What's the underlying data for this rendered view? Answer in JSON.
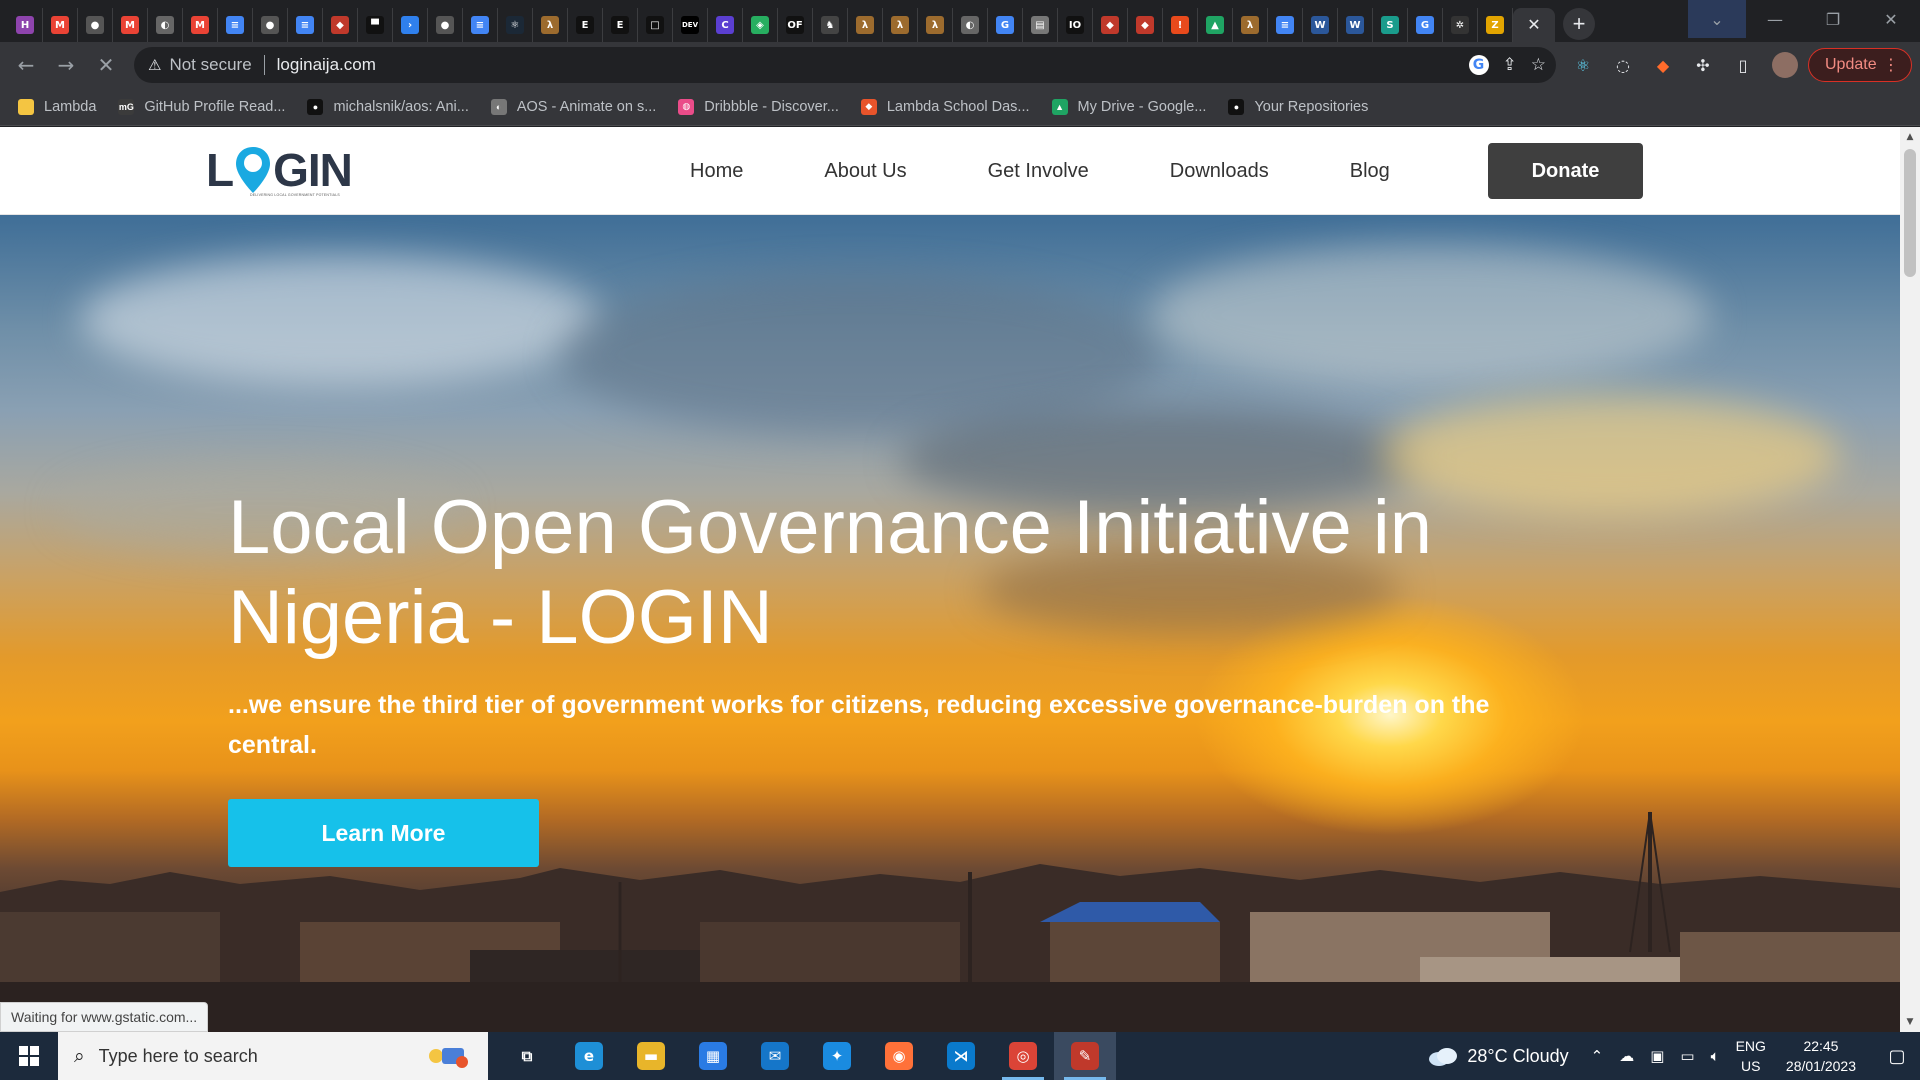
{
  "browser": {
    "tab_favicons": [
      {
        "name": "h-icon",
        "glyph": "H",
        "color": "#8e44ad"
      },
      {
        "name": "gmail-icon",
        "glyph": "M",
        "color": "#ea4335"
      },
      {
        "name": "github-icon",
        "glyph": "●",
        "color": "#555"
      },
      {
        "name": "gmail-icon",
        "glyph": "M",
        "color": "#ea4335"
      },
      {
        "name": "globe-icon",
        "glyph": "◐",
        "color": "#666"
      },
      {
        "name": "gmail-icon",
        "glyph": "M",
        "color": "#ea4335"
      },
      {
        "name": "docs-icon",
        "glyph": "≡",
        "color": "#4285f4"
      },
      {
        "name": "github-icon",
        "glyph": "●",
        "color": "#555"
      },
      {
        "name": "docs-icon",
        "glyph": "≡",
        "color": "#4285f4"
      },
      {
        "name": "shield-icon",
        "glyph": "◆",
        "color": "#c0392b"
      },
      {
        "name": "bag-icon",
        "glyph": "▀",
        "color": "#111"
      },
      {
        "name": "code-icon",
        "glyph": "›",
        "color": "#2f80ed"
      },
      {
        "name": "github-icon",
        "glyph": "●",
        "color": "#555"
      },
      {
        "name": "docs-icon",
        "glyph": "≡",
        "color": "#4285f4"
      },
      {
        "name": "react-icon",
        "glyph": "⚛",
        "color": "#1b2836"
      },
      {
        "name": "lambda-icon",
        "glyph": "λ",
        "color": "#9c6b2e"
      },
      {
        "name": "e-icon",
        "glyph": "E",
        "color": "#111"
      },
      {
        "name": "e-icon",
        "glyph": "E",
        "color": "#111"
      },
      {
        "name": "square-icon",
        "glyph": "□",
        "color": "#111"
      },
      {
        "name": "dev-icon",
        "glyph": "DEV",
        "color": "#000"
      },
      {
        "name": "c-icon",
        "glyph": "C",
        "color": "#5b3fd1"
      },
      {
        "name": "layers-icon",
        "glyph": "◈",
        "color": "#27ae60"
      },
      {
        "name": "of-icon",
        "glyph": "OF",
        "color": "#111"
      },
      {
        "name": "person-icon",
        "glyph": "♞",
        "color": "#444"
      },
      {
        "name": "lambda-icon",
        "glyph": "λ",
        "color": "#9c6b2e"
      },
      {
        "name": "lambda-icon",
        "glyph": "λ",
        "color": "#9c6b2e"
      },
      {
        "name": "lambda-icon",
        "glyph": "λ",
        "color": "#9c6b2e"
      },
      {
        "name": "globe-icon",
        "glyph": "◐",
        "color": "#666"
      },
      {
        "name": "google-icon",
        "glyph": "G",
        "color": "#4285f4"
      },
      {
        "name": "page-icon",
        "glyph": "▤",
        "color": "#777"
      },
      {
        "name": "io-icon",
        "glyph": "IO",
        "color": "#111"
      },
      {
        "name": "brave-icon",
        "glyph": "◆",
        "color": "#c0392b"
      },
      {
        "name": "brave-icon",
        "glyph": "◆",
        "color": "#c0392b"
      },
      {
        "name": "alert-icon",
        "glyph": "!",
        "color": "#e84a1c"
      },
      {
        "name": "drive-icon",
        "glyph": "▲",
        "color": "#1fa463"
      },
      {
        "name": "lambda-icon",
        "glyph": "λ",
        "color": "#9c6b2e"
      },
      {
        "name": "docs-icon",
        "glyph": "≡",
        "color": "#4285f4"
      },
      {
        "name": "word-icon",
        "glyph": "W",
        "color": "#2b579a"
      },
      {
        "name": "word-icon",
        "glyph": "W",
        "color": "#2b579a"
      },
      {
        "name": "s-icon",
        "glyph": "S",
        "color": "#1a9c8c"
      },
      {
        "name": "google-icon",
        "glyph": "G",
        "color": "#4285f4"
      },
      {
        "name": "gear-icon",
        "glyph": "✲",
        "color": "#333"
      },
      {
        "name": "zoho-icon",
        "glyph": "Z",
        "color": "#e2a400"
      }
    ],
    "address": {
      "security_label": "Not secure",
      "url": "loginaija.com"
    },
    "update_label": "Update",
    "bookmarks": [
      {
        "label": "Lambda",
        "color": "#f4c542",
        "glyph": ""
      },
      {
        "label": "GitHub Profile Read...",
        "color": "#3b3b3b",
        "glyph": "mG"
      },
      {
        "label": "michalsnik/aos: Ani...",
        "color": "#111",
        "glyph": "●"
      },
      {
        "label": "AOS - Animate on s...",
        "color": "#777",
        "glyph": "◐"
      },
      {
        "label": "Dribbble - Discover...",
        "color": "#ea4c89",
        "glyph": "◍"
      },
      {
        "label": "Lambda School Das...",
        "color": "#e8542b",
        "glyph": "◆"
      },
      {
        "label": "My Drive - Google...",
        "color": "#1fa463",
        "glyph": "▲"
      },
      {
        "label": "Your Repositories",
        "color": "#111",
        "glyph": "●"
      }
    ],
    "status_text": "Waiting for www.gstatic.com..."
  },
  "site": {
    "logo_text_left": "L",
    "logo_text_right": "GIN",
    "logo_tagline": "DELIVERING LOCAL GOVERNMENT POTENTIALS",
    "nav": [
      "Home",
      "About Us",
      "Get Involve",
      "Downloads",
      "Blog"
    ],
    "donate_label": "Donate",
    "hero": {
      "title": "Local Open Governance Initiative in Nigeria - LOGIN",
      "subtitle": "...we ensure the third tier of government works for citizens, reducing excessive governance-burden on the central.",
      "cta_label": "Learn More"
    },
    "colors": {
      "cta": "#16c1ea",
      "donate": "#3f3f3f",
      "logo_pin": "#1aa9e1"
    }
  },
  "taskbar": {
    "search_placeholder": "Type here to search",
    "apps": [
      {
        "name": "task-view-icon",
        "glyph": "⧉",
        "color": "transparent"
      },
      {
        "name": "edge-icon",
        "glyph": "e",
        "color": "#1e8fd6"
      },
      {
        "name": "file-explorer-icon",
        "glyph": "▬",
        "color": "#e8b52a"
      },
      {
        "name": "store-icon",
        "glyph": "▦",
        "color": "#2a7be4"
      },
      {
        "name": "mail-icon",
        "glyph": "✉",
        "color": "#1576c9"
      },
      {
        "name": "safari-icon",
        "glyph": "✦",
        "color": "#1a8be0"
      },
      {
        "name": "firefox-icon",
        "glyph": "◉",
        "color": "#ff7139"
      },
      {
        "name": "vscode-icon",
        "glyph": "⋊",
        "color": "#0a7acc"
      },
      {
        "name": "chrome-icon",
        "glyph": "◎",
        "color": "#db4437"
      },
      {
        "name": "app-icon",
        "glyph": "✎",
        "color": "#c0392b"
      }
    ],
    "weather": "28°C  Cloudy",
    "lang_top": "ENG",
    "lang_bottom": "US",
    "time": "22:45",
    "date": "28/01/2023"
  }
}
